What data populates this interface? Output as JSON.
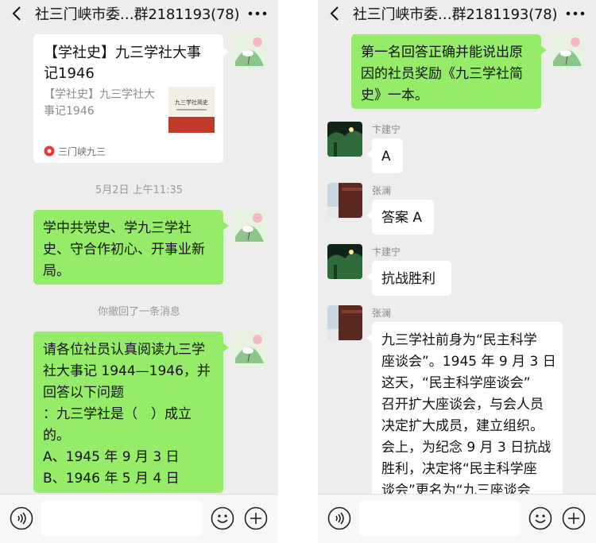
{
  "left": {
    "title": "社三门峡市委…群2181193(78)",
    "card": {
      "title": "【学社史】九三学社大事记1946",
      "desc": "【学社史】九三学社大事记1946",
      "thumb_title": "九三学社简史",
      "source": "三门峡九三"
    },
    "time1": "5月2日 上午11:35",
    "msg1": [
      "学中共党史、学九三学社",
      "史、守合作初心、开事业新",
      "局。"
    ],
    "recall": "你撤回了一条消息",
    "msg2": [
      "请各位社员认真阅读九三学",
      "社大事记 1944—1946，并",
      "回答以下问题",
      "：九三学社是（　）成立",
      "的。",
      "A、1945 年 9 月 3 日",
      "B、1946 年 5 月 4 日"
    ]
  },
  "right": {
    "title": "社三门峡市委…群2181193(78)",
    "msg_top": [
      "第一名回答正确并能说出原",
      "因的社员奖励《九三学社简",
      "史》一本。"
    ],
    "messages": [
      {
        "sender": "卞建宁",
        "text": "A"
      },
      {
        "sender": "张澜",
        "text": "答案 A"
      },
      {
        "sender": "卞建宁",
        "text": "抗战胜利"
      },
      {
        "sender": "张澜",
        "lines": [
          "九三学社前身为“民主科学",
          "座谈会”。1945 年 9 月 3 日",
          "这天，“民主科学座谈会”",
          "召开扩大座谈会，与会人员",
          "决定扩大成员，建立组织。",
          "会上，为纪念 9 月 3 日抗战",
          "胜利，决定将“民主科学座",
          "谈会”更名为“九三座谈会"
        ]
      }
    ]
  },
  "colors": {
    "bubble_green": "#95ec69",
    "bubble_white": "#ffffff",
    "background": "#ededed"
  },
  "icons": [
    "back-arrow",
    "more-dots",
    "voice",
    "emoji",
    "plus",
    "article-source-logo"
  ]
}
